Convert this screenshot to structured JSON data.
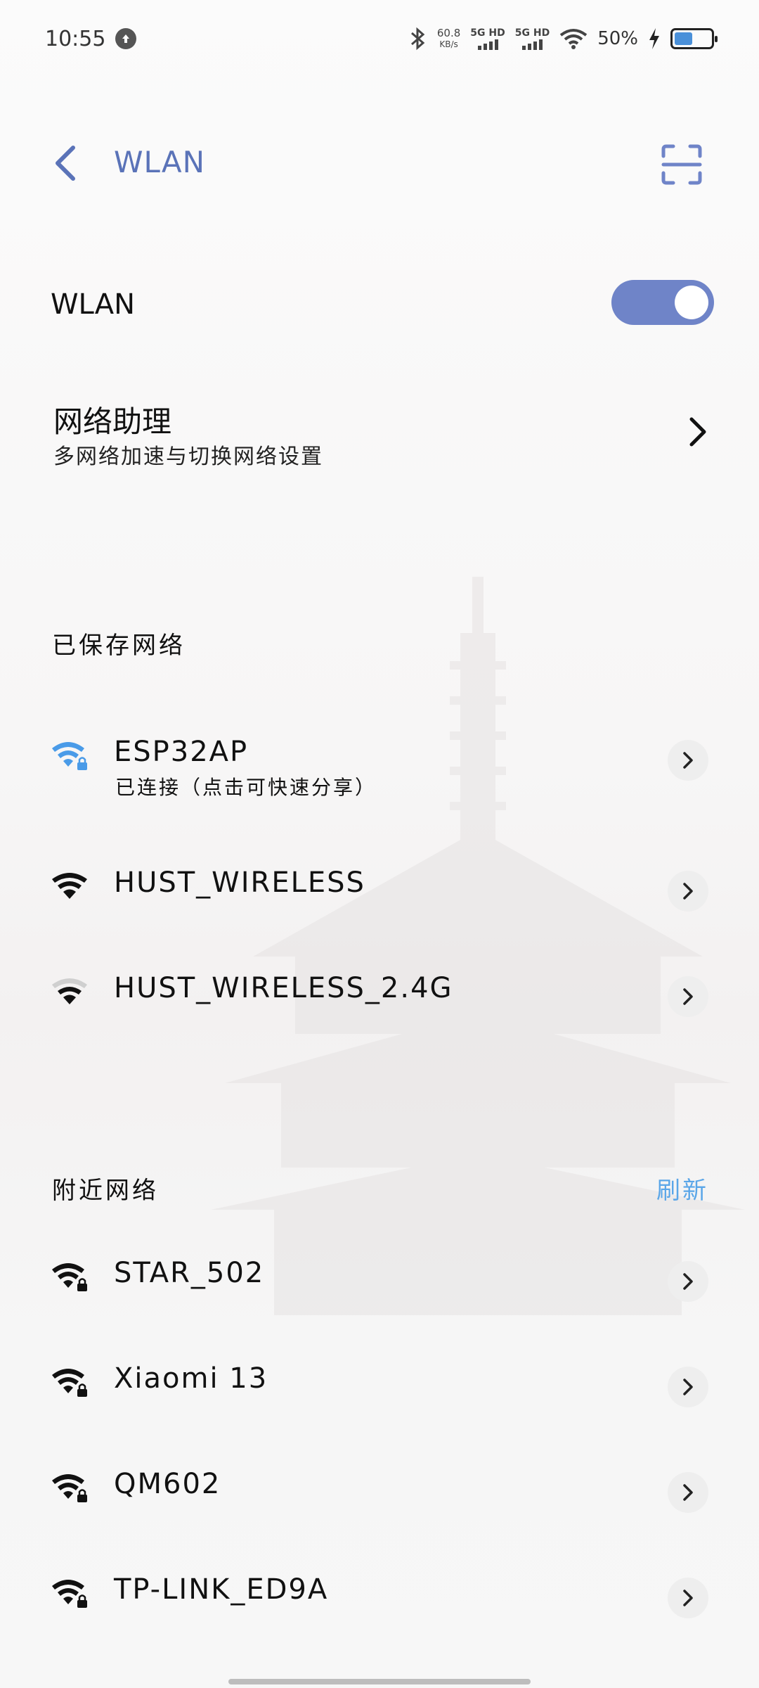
{
  "status_bar": {
    "time": "10:55",
    "speed_value": "60.8",
    "speed_unit": "KB/s",
    "sim1_label": "5G HD",
    "sim2_label": "5G HD",
    "battery_percent": "50%",
    "battery_level": 0.5
  },
  "header": {
    "title": "WLAN",
    "back_icon": "chevron-left-icon",
    "scan_icon": "scan-icon"
  },
  "wlan_toggle": {
    "label": "WLAN",
    "enabled": true
  },
  "assistant": {
    "title": "网络助理",
    "subtitle": "多网络加速与切换网络设置"
  },
  "saved_networks": {
    "title": "已保存网络",
    "items": [
      {
        "name": "ESP32AP",
        "status": "已连接（点击可快速分享）",
        "connected": true,
        "locked": true
      },
      {
        "name": "HUST_WIRELESS",
        "status": "",
        "connected": false,
        "locked": false
      },
      {
        "name": "HUST_WIRELESS_2.4G",
        "status": "",
        "connected": false,
        "locked": false
      }
    ]
  },
  "nearby_networks": {
    "title": "附近网络",
    "refresh_label": "刷新",
    "items": [
      {
        "name": "STAR_502",
        "locked": true
      },
      {
        "name": "Xiaomi 13",
        "locked": true
      },
      {
        "name": "QM602",
        "locked": true
      },
      {
        "name": "TP-LINK_ED9A",
        "locked": true
      }
    ]
  },
  "colors": {
    "accent": "#6f84c8",
    "title": "#5a73b8",
    "refresh": "#5aa6e8",
    "connected_wifi": "#4a9be8"
  }
}
